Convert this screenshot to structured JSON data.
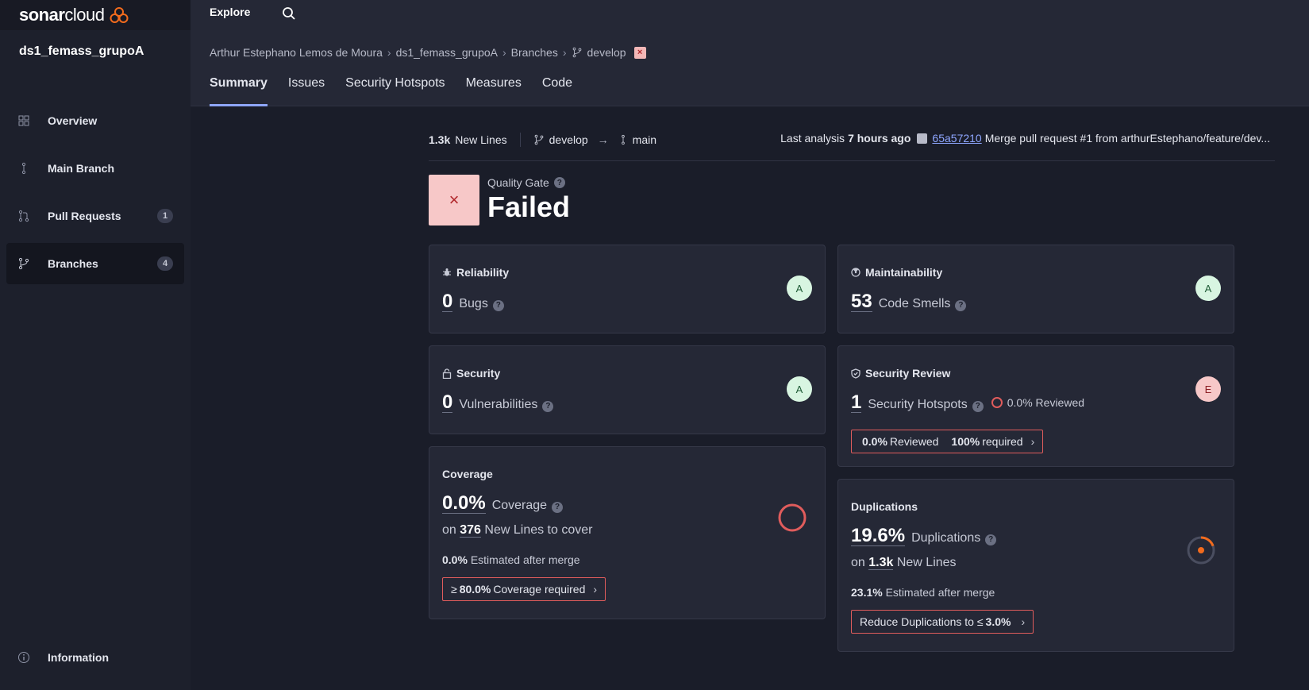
{
  "app": {
    "logo_text_bold": "sonar",
    "logo_text_light": "cloud",
    "project_name": "ds1_femass_grupoA"
  },
  "sidebar": {
    "items": [
      {
        "label": "Overview",
        "icon": "grid-icon",
        "badge": ""
      },
      {
        "label": "Main Branch",
        "icon": "branch-main-icon",
        "badge": ""
      },
      {
        "label": "Pull Requests",
        "icon": "pull-request-icon",
        "badge": "1"
      },
      {
        "label": "Branches",
        "icon": "branch-icon",
        "badge": "4"
      }
    ],
    "info_label": "Information"
  },
  "topbar": {
    "explore_label": "Explore"
  },
  "breadcrumb": {
    "owner": "Arthur Estephano Lemos de Moura",
    "project": "ds1_femass_grupoA",
    "branches": "Branches",
    "branch": "develop",
    "status_mark": "×"
  },
  "tabs": [
    "Summary",
    "Issues",
    "Security Hotspots",
    "Measures",
    "Code"
  ],
  "summary": {
    "new_lines_value": "1.3k",
    "new_lines_label": "New Lines",
    "source_branch": "develop",
    "target_branch": "main",
    "last_analysis_label": "Last analysis",
    "last_analysis_time": "7 hours ago",
    "commit_hash": "65a57210",
    "commit_message": "Merge pull request #1 from arthurEstephano/feature/dev..."
  },
  "quality_gate": {
    "label": "Quality Gate",
    "status": "Failed",
    "mark": "×"
  },
  "cards": {
    "reliability": {
      "title": "Reliability",
      "value": "0",
      "label": "Bugs",
      "rating": "A"
    },
    "maintainability": {
      "title": "Maintainability",
      "value": "53",
      "label": "Code Smells",
      "rating": "A"
    },
    "security": {
      "title": "Security",
      "value": "0",
      "label": "Vulnerabilities",
      "rating": "A"
    },
    "security_review": {
      "title": "Security Review",
      "value": "1",
      "label": "Security Hotspots",
      "rating": "E",
      "reviewed_inline": "0.0% Reviewed",
      "req_value": "0.0%",
      "req_text": "Reviewed",
      "req_required_value": "100%",
      "req_required_text": "required"
    },
    "coverage": {
      "title": "Coverage",
      "value": "0.0%",
      "label": "Coverage",
      "on_prefix": "on",
      "lines_value": "376",
      "lines_label": "New Lines to cover",
      "estimated_value": "0.0%",
      "estimated_label": "Estimated after merge",
      "req_prefix": "≥",
      "req_value": "80.0%",
      "req_text": "Coverage required",
      "coverage_fraction": 0.0
    },
    "duplications": {
      "title": "Duplications",
      "value": "19.6%",
      "label": "Duplications",
      "on_prefix": "on",
      "lines_value": "1.3k",
      "lines_label": "New Lines",
      "estimated_value": "23.1%",
      "estimated_label": "Estimated after merge",
      "req_text": "Reduce Duplications to ≤",
      "req_value": "3.0%",
      "duplication_fraction": 0.196
    }
  },
  "colors": {
    "accent": "#8ea6ff",
    "error": "#e05c5c",
    "rating_a_bg": "#d8f5e1",
    "rating_e_bg": "#f7c8c8",
    "dup_ring": "#f26b1d"
  }
}
